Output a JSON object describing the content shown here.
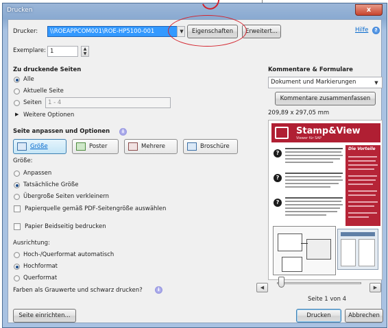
{
  "window": {
    "title": "Drucken",
    "close_label": "x"
  },
  "printer": {
    "label": "Drucker:",
    "value": "\\\\ROEAPPCOM001\\ROE-HP5100-001",
    "properties_label": "Eigenschaften",
    "advanced_label": "Erweitert...",
    "help_label": "Hilfe"
  },
  "copies": {
    "label": "Exemplare:",
    "value": "1"
  },
  "pages_to_print": {
    "heading": "Zu druckende Seiten",
    "options": [
      "Alle",
      "Aktuelle Seite",
      "Seiten"
    ],
    "selected": "Alle",
    "pages_placeholder": "1 - 4",
    "more_options_label": "Weitere Optionen"
  },
  "page_sizing": {
    "heading": "Seite anpassen und Optionen",
    "tabs": [
      "Größe",
      "Poster",
      "Mehrere",
      "Broschüre"
    ],
    "active_tab": "Größe",
    "size_label": "Größe:",
    "size_options": [
      "Anpassen",
      "Tatsächliche Größe",
      "Übergroße Seiten verkleinern"
    ],
    "size_selected": "Tatsächliche Größe",
    "paper_source_label": "Papierquelle gemäß PDF-Seitengröße auswählen",
    "duplex_label": "Papier Beidseitig bedrucken"
  },
  "orientation": {
    "label": "Ausrichtung:",
    "options": [
      "Hoch-/Querformat automatisch",
      "Hochformat",
      "Querformat"
    ],
    "selected": "Hochformat"
  },
  "grayscale_label": "Farben als Grauwerte und schwarz drucken?",
  "comments": {
    "heading": "Kommentare & Formulare",
    "select_value": "Dokument und Markierungen",
    "summarize_label": "Kommentare zusammenfassen",
    "page_dims": "209,89 x 297,05 mm"
  },
  "preview": {
    "logo_text": "Stamp&View",
    "sub_text": "Viewer für SAP",
    "side_title": "Die Vorteile",
    "page_indicator": "Seite 1 von 4"
  },
  "footer": {
    "page_setup_label": "Seite einrichten...",
    "print_label": "Drucken",
    "cancel_label": "Abbrechen"
  },
  "colors": {
    "accent": "#3399ff",
    "title_bar": "#8aaad1",
    "highlight_circle": "#d3202a",
    "brand_red": "#b01f33"
  }
}
